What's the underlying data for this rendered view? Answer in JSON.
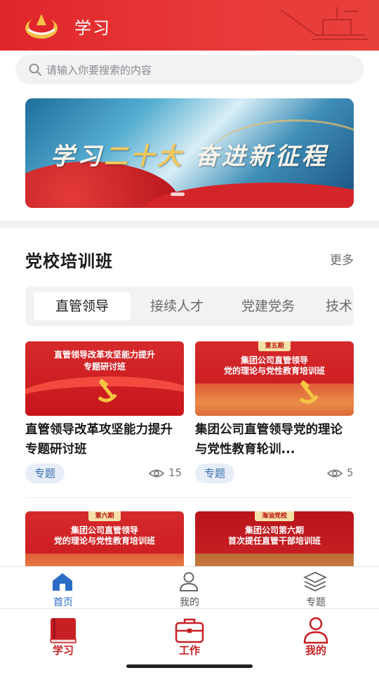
{
  "header": {
    "title": "学习"
  },
  "search": {
    "placeholder": "请输入你要搜索的内容"
  },
  "banner": {
    "text_left": "学习",
    "text_mid": "二十大",
    "text_right": "奋进新征程"
  },
  "section": {
    "title": "党校培训班",
    "more": "更多"
  },
  "tabs": [
    {
      "label": "直管领导",
      "active": true
    },
    {
      "label": "接续人才"
    },
    {
      "label": "党建党务"
    },
    {
      "label": "技术"
    }
  ],
  "cards": [
    {
      "img_line1": "直管领导改革攻坚能力提升",
      "img_line2": "专题研讨班",
      "img_badge": "",
      "title": "直管领导改革攻坚能力提升专题研讨班",
      "tag": "专题",
      "views": "15"
    },
    {
      "img_line1": "集团公司直管领导",
      "img_line2": "党的理论与党性教育培训班",
      "img_badge": "第五期",
      "title": "集团公司直管领导党的理论与党性教育轮训...",
      "tag": "专题",
      "views": "5"
    },
    {
      "img_line1": "集团公司直管领导",
      "img_line2": "党的理论与党性教育培训班",
      "img_badge": "第六期"
    },
    {
      "img_line1": "集团公司第六期",
      "img_line2": "首次提任直管干部培训班",
      "img_badge": "海油党校"
    }
  ],
  "inner_nav": [
    {
      "label": "首页",
      "icon": "home-icon",
      "active": true
    },
    {
      "label": "我的",
      "icon": "user-icon"
    },
    {
      "label": "专题",
      "icon": "layers-icon"
    }
  ],
  "bottom_nav": [
    {
      "label": "学习",
      "icon": "book-icon"
    },
    {
      "label": "工作",
      "icon": "briefcase-icon"
    },
    {
      "label": "我的",
      "icon": "person-icon"
    }
  ],
  "colors": {
    "brand_red": "#e0262b",
    "accent_blue": "#2b6cc4",
    "tag_blue": "#3a6fb0"
  }
}
